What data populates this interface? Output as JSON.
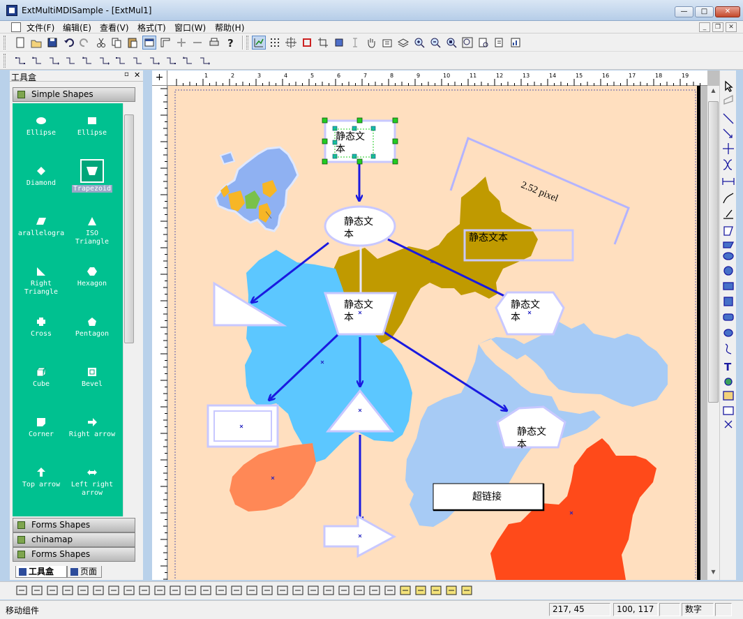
{
  "window": {
    "title": "ExtMultiMDISample - [ExtMul1]",
    "min": "—",
    "max": "□",
    "close": "✕"
  },
  "menu": [
    "文件(F)",
    "编辑(E)",
    "查看(V)",
    "格式(T)",
    "窗口(W)",
    "帮助(H)"
  ],
  "toolbox": {
    "title": "工具盒",
    "category_open": "Simple Shapes",
    "tools": [
      {
        "label": "Ellipse",
        "icon": "ellipse-icon"
      },
      {
        "label": "Ellipse",
        "icon": "rectangle-icon"
      },
      {
        "label": "Diamond",
        "icon": "diamond-icon"
      },
      {
        "label": "Trapezoid",
        "icon": "trapezoid-icon",
        "selected": true
      },
      {
        "label": "arallelogra",
        "icon": "parallelogram-icon"
      },
      {
        "label": "ISO Triangle",
        "icon": "iso-triangle-icon"
      },
      {
        "label": "Right Triangle",
        "icon": "right-triangle-icon"
      },
      {
        "label": "Hexagon",
        "icon": "hexagon-icon"
      },
      {
        "label": "Cross",
        "icon": "cross-icon"
      },
      {
        "label": "Pentagon",
        "icon": "pentagon-icon"
      },
      {
        "label": "Cube",
        "icon": "cube-icon"
      },
      {
        "label": "Bevel",
        "icon": "bevel-icon"
      },
      {
        "label": "Corner",
        "icon": "corner-icon"
      },
      {
        "label": "Right arrow",
        "icon": "right-arrow-icon"
      },
      {
        "label": "Top arrow",
        "icon": "top-arrow-icon"
      },
      {
        "label": "Left right arrow",
        "icon": "left-right-arrow-icon"
      }
    ],
    "categories_bottom": [
      "Forms Shapes",
      "chinamap",
      "Forms Shapes"
    ],
    "tabs": [
      "工具盒",
      "页面"
    ]
  },
  "ruler": {
    "h_ticks": [
      "1",
      "2",
      "3",
      "4",
      "5",
      "6",
      "7",
      "8",
      "9",
      "10",
      "11",
      "12",
      "13",
      "14",
      "15",
      "16",
      "17",
      "18",
      "19"
    ]
  },
  "canvas": {
    "node_text": "静态文本",
    "label_box": "静态文本",
    "dimension": "2.52 pixel",
    "hyperlink": "超链接"
  },
  "colors": {
    "page": "#ffdfbf",
    "gold": "#c09a00",
    "lightblue": "#5cc7ff",
    "paleblue": "#a7cbf5",
    "salmon": "#ff8856",
    "red": "#ff4a1a",
    "arrow": "#1a1ae0",
    "shape_border": "#c8c8ff"
  },
  "status": {
    "message": "移动组件",
    "pos": "217, 45",
    "size": "100, 117",
    "mode": "数字"
  }
}
